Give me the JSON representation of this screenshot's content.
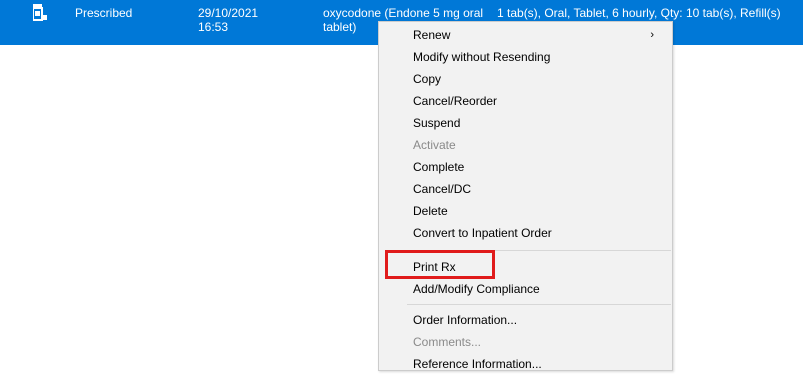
{
  "order_row": {
    "icon": "medication-icon",
    "status": "Prescribed",
    "date": "29/10/2021",
    "time": "16:53",
    "drug_line1": "oxycodone (Endone 5 mg oral",
    "drug_line2": "tablet)",
    "details": "1 tab(s), Oral, Tablet, 6 hourly, Qty: 10 tab(s), Refill(s)"
  },
  "context_menu": {
    "items": [
      {
        "label": "Renew",
        "submenu": "›"
      },
      {
        "label": "Modify without Resending"
      },
      {
        "label": "Copy"
      },
      {
        "label": "Cancel/Reorder"
      },
      {
        "label": "Suspend"
      },
      {
        "label": "Activate",
        "disabled": true
      },
      {
        "label": "Complete"
      },
      {
        "label": "Cancel/DC"
      },
      {
        "label": "Delete"
      },
      {
        "label": "Convert to Inpatient Order"
      },
      {
        "label": "Print Rx",
        "highlighted": true
      },
      {
        "label": "Add/Modify Compliance"
      },
      {
        "label": "Order Information..."
      },
      {
        "label": "Comments...",
        "disabled": true
      },
      {
        "label": "Reference Information..."
      }
    ]
  },
  "colors": {
    "selection": "#0078d7",
    "menu_bg": "#f2f2f2",
    "highlight_border": "#e01b1b",
    "disabled_text": "#8a8a8a"
  }
}
